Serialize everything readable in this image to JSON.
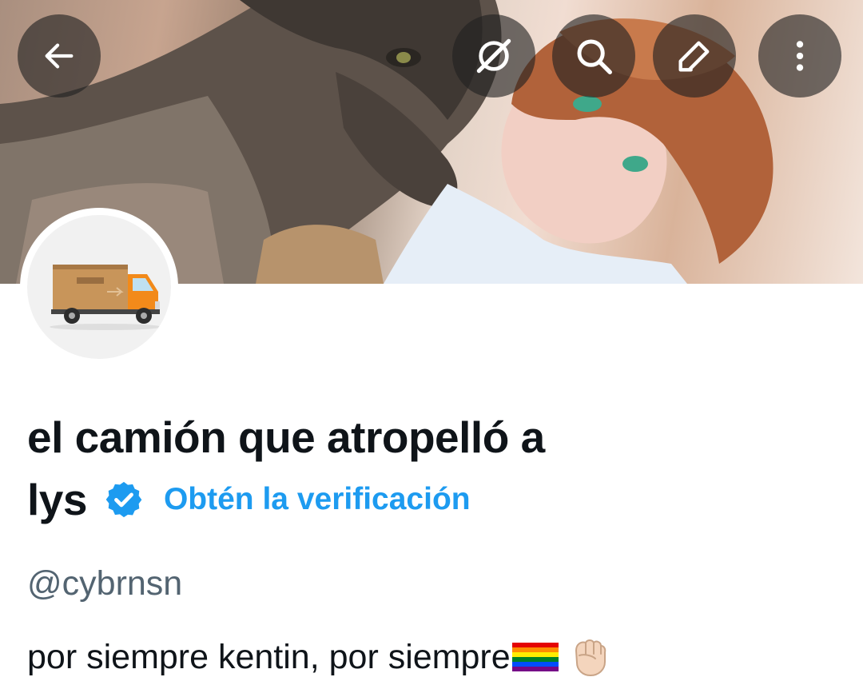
{
  "header": {
    "back_icon": "arrow-left-icon",
    "actions": [
      "grok-icon",
      "search-icon",
      "edit-icon",
      "more-vertical-icon"
    ]
  },
  "profile": {
    "name_line1": "el camión que atropelló a",
    "name_line2": "lys",
    "verified_badge_icon": "verified-check-icon",
    "verified_color": "#1d9bf0",
    "get_verified_link": "Obtén la verificación",
    "handle": "@cybrnsn",
    "bio_text": "por siempre kentin, por siempre",
    "bio_emojis": [
      "rainbow-flag",
      "raised-fist-light-skin-tone"
    ]
  },
  "colors": {
    "text_primary": "#0f1419",
    "text_secondary": "#536471",
    "accent": "#1d9bf0"
  }
}
